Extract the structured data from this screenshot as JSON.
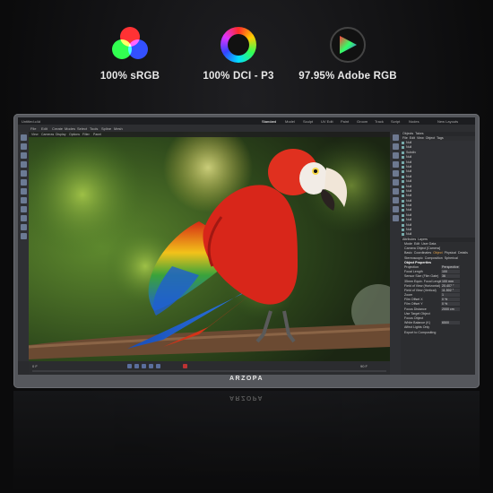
{
  "badges": [
    {
      "label": "100% sRGB",
      "icon": "rgb-circles-icon"
    },
    {
      "label": "100% DCI - P3",
      "icon": "color-ring-icon"
    },
    {
      "label": "97.95% Adobe RGB",
      "icon": "color-triangle-icon"
    }
  ],
  "brand": "ARZOPA",
  "app": {
    "file_tab": "Untitled.c4d",
    "layouts": [
      "Standard",
      "Model",
      "Sculpt",
      "UV Edit",
      "Paint",
      "Groom",
      "Track",
      "Script",
      "Nodes"
    ],
    "new_layouts": "New Layouts",
    "menus": [
      "File",
      "Edit",
      "Create",
      "Modes",
      "Select",
      "Tools",
      "Spline",
      "Mesh",
      "Volume",
      "MoGraph",
      "Character",
      "Animate",
      "Simulate",
      "Tracker",
      "Render",
      "Extensions",
      "Window",
      "Help"
    ],
    "viewport_menu": [
      "View",
      "Cameras",
      "Display",
      "Options",
      "Filter",
      "Panel"
    ],
    "timeline": {
      "current": "0 F",
      "end": "90 F"
    },
    "objects_panel": {
      "tabs": [
        "Objects",
        "Takes"
      ],
      "menu": [
        "File",
        "Edit",
        "View",
        "Object",
        "Tags"
      ],
      "items": [
        "Null",
        "Null",
        "Subdiv",
        "Null",
        "Null",
        "Null",
        "Null",
        "Null",
        "Null",
        "Null",
        "Null",
        "Null",
        "Null",
        "Null",
        "Null",
        "Null",
        "Null",
        "Null",
        "Null",
        "Null"
      ]
    },
    "attributes_panel": {
      "tabs": [
        "Attributes",
        "Layers"
      ],
      "menu": [
        "Mode",
        "Edit",
        "User Data"
      ],
      "title": "Camera Object [Camera]",
      "sub_tabs": [
        "Basic",
        "Coordinates",
        "Object",
        "Physical",
        "Details",
        "Stereoscopic",
        "Composition",
        "Spherical"
      ],
      "section": "Object Properties",
      "rows": [
        {
          "label": "Projection",
          "value": "Perspective"
        },
        {
          "label": "Focal Length",
          "value": "100"
        },
        {
          "label": "Sensor Size (Film Gate)",
          "value": "36"
        },
        {
          "label": "35mm Equiv. Focal Length",
          "value": "100 mm"
        },
        {
          "label": "Field of View (Horizontal)",
          "value": "20.407 °"
        },
        {
          "label": "Field of View (Vertical)",
          "value": "11.502 °"
        },
        {
          "label": "Zoom",
          "value": "1"
        },
        {
          "label": "Film Offset X",
          "value": "0 %"
        },
        {
          "label": "Film Offset Y",
          "value": "0 %"
        },
        {
          "label": "Focus Distance",
          "value": "2000 cm"
        },
        {
          "label": "Use Target Object",
          "value": ""
        },
        {
          "label": "Focus Object",
          "value": ""
        },
        {
          "label": "White Balance (K)",
          "value": "6500"
        },
        {
          "label": "Affect Lights Only",
          "value": ""
        },
        {
          "label": "Export to Compositing",
          "value": ""
        }
      ]
    }
  },
  "colors": {
    "accent": "#e8a44a",
    "timeline_button": "#5a6e9c",
    "bg": "#0d0d0e"
  }
}
